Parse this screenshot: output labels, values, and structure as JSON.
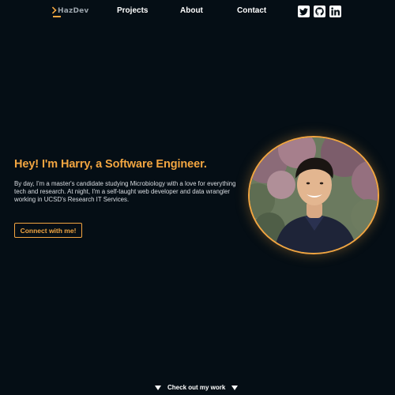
{
  "nav": {
    "logo_text": "HazDev",
    "links": [
      {
        "label": "Projects"
      },
      {
        "label": "About"
      },
      {
        "label": "Contact"
      }
    ],
    "social_icons": [
      "twitter-icon",
      "github-icon",
      "linkedin-icon"
    ]
  },
  "hero": {
    "title": "Hey! I'm Harry, a Software Engineer.",
    "description": "By day, I'm a master's candidate studying Microbiology with a love for everything tech and research. At night, I'm a self-taught web developer and data wrangler working in UCSD's Research IT Services.",
    "cta_label": "Connect with me!"
  },
  "scroll_cue": {
    "label": "Check out my work"
  },
  "colors": {
    "background": "#050e15",
    "accent": "#f2a541",
    "text": "#ffffff"
  }
}
